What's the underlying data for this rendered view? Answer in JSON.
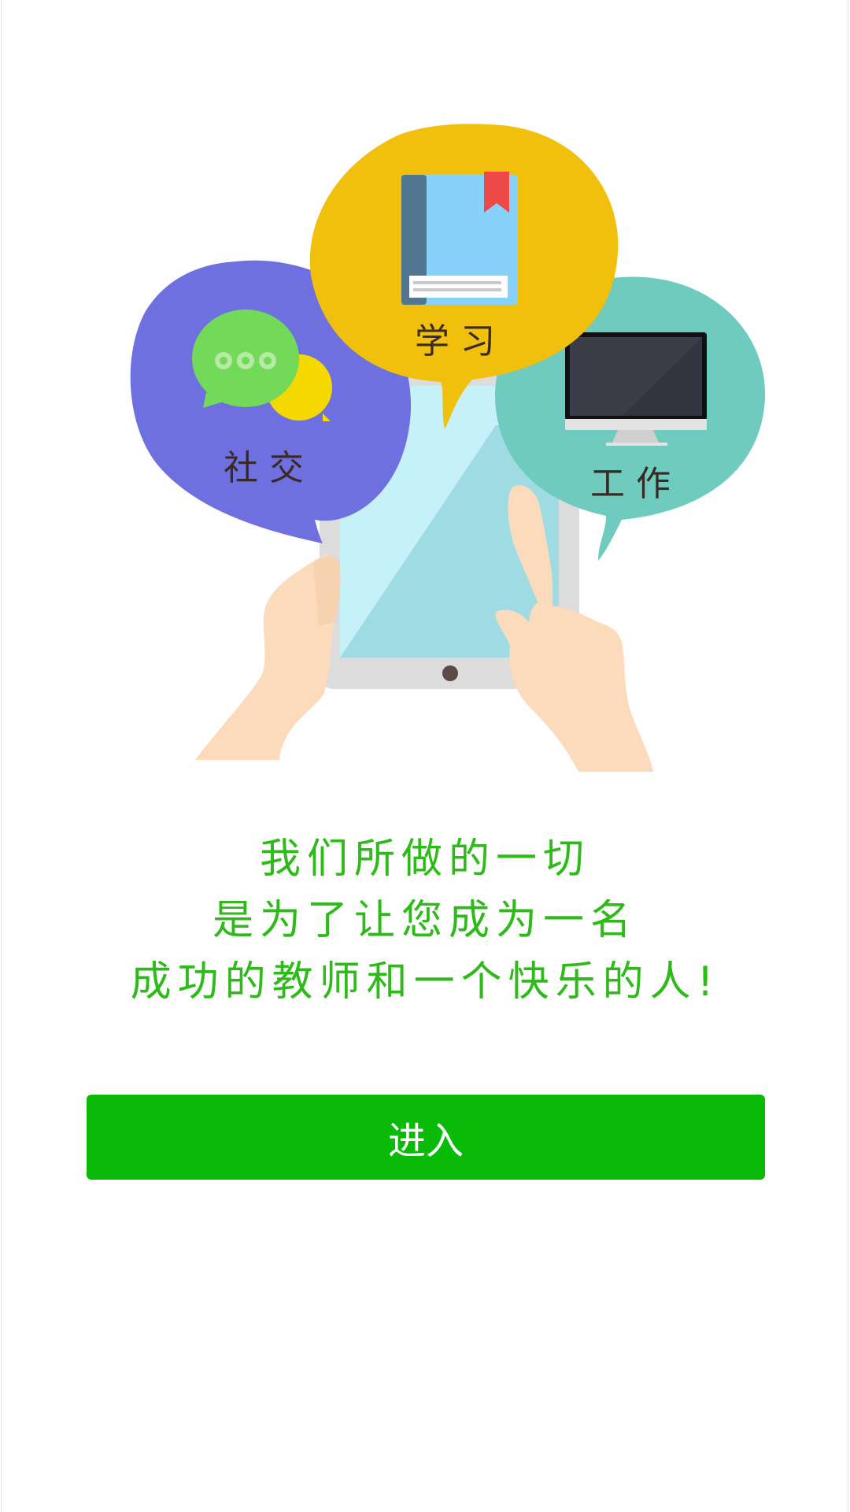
{
  "bubbles": {
    "social": {
      "label": "社交",
      "color": "#6e70e0",
      "icon": "chat-bubbles-icon"
    },
    "study": {
      "label": "学习",
      "color": "#f0c00d",
      "icon": "book-icon"
    },
    "work": {
      "label": "工作",
      "color": "#6ecbbe",
      "icon": "monitor-icon"
    }
  },
  "slogan": {
    "line1": "我们所做的一切",
    "line2": "是为了让您成为一名",
    "line3": "成功的教师和一个快乐的人!"
  },
  "enter_button": {
    "label": "进入",
    "color": "#09bb07"
  }
}
